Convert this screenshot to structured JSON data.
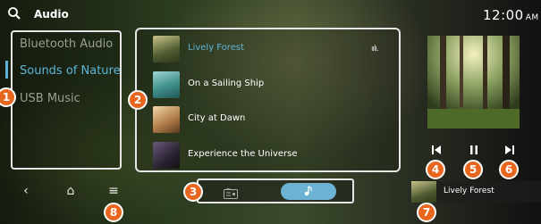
{
  "header": {
    "search_icon": "magnifier-icon",
    "title": "Audio",
    "time": "12:00",
    "ampm": "AM"
  },
  "sidebar": {
    "items": [
      {
        "label": "Bluetooth Audio",
        "selected": false
      },
      {
        "label": "Sounds of Nature",
        "selected": true
      },
      {
        "label": "USB Music",
        "selected": false
      }
    ]
  },
  "tracks": [
    {
      "title": "Lively Forest",
      "playing": true,
      "indicator": "ıılı."
    },
    {
      "title": "On a Sailing Ship",
      "playing": false
    },
    {
      "title": "City at Dawn",
      "playing": false
    },
    {
      "title": "Experience the Universe",
      "playing": false
    }
  ],
  "player": {
    "prev_icon": "skip-previous-icon",
    "pause_icon": "pause-icon",
    "next_icon": "skip-next-icon"
  },
  "mini_player": {
    "title": "Lively Forest"
  },
  "bottom_nav": {
    "back": "‹",
    "home": "⌂",
    "menu": "≡"
  },
  "colors": {
    "accent": "#5db4d8",
    "callout": "#e9661e"
  },
  "callouts": [
    "1",
    "2",
    "3",
    "4",
    "5",
    "6",
    "7",
    "8"
  ]
}
